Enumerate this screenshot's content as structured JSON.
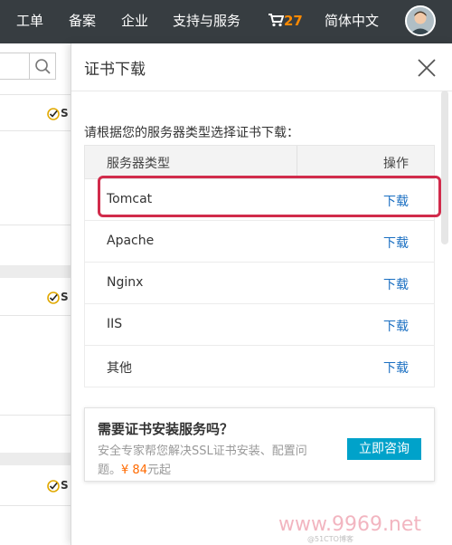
{
  "topbar": {
    "items": [
      "工单",
      "备案",
      "企业",
      "支持与服务"
    ],
    "cart_count": "27",
    "language": "简体中文"
  },
  "background": {
    "badge_letter": "S"
  },
  "panel": {
    "title": "证书下载",
    "instruction": "请根据您的服务器类型选择证书下载：",
    "table": {
      "headers": [
        "服务器类型",
        "操作"
      ],
      "rows": [
        {
          "server": "Tomcat",
          "action": "下载"
        },
        {
          "server": "Apache",
          "action": "下载"
        },
        {
          "server": "Nginx",
          "action": "下载"
        },
        {
          "server": "IIS",
          "action": "下载"
        },
        {
          "server": "其他",
          "action": "下载"
        }
      ]
    },
    "promo": {
      "title": "需要证书安装服务吗？",
      "desc_line1": "安全专家帮您解决SSL证书安装、配置问",
      "desc_line2_prefix": "题。",
      "price": "¥ 84",
      "desc_line2_suffix": "元起",
      "button": "立即咨询"
    }
  },
  "watermark": {
    "site": "www.9969.net",
    "small": "@51CTO博客"
  },
  "colors": {
    "topbar_bg": "#373d41",
    "cart_count": "#ff8a00",
    "link": "#1a6fc2",
    "highlight": "#d12b4b",
    "consult_button": "#00a2ca",
    "price": "#ff6a00"
  }
}
